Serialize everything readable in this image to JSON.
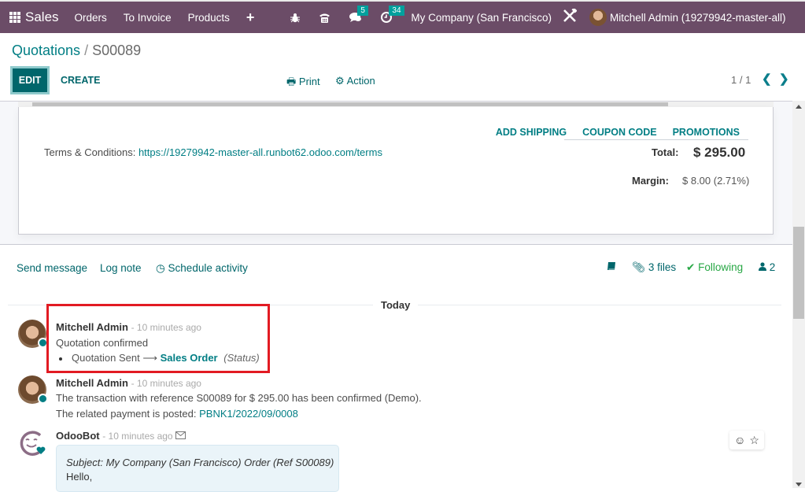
{
  "topbar": {
    "app_name": "Sales",
    "menu": [
      "Orders",
      "To Invoice",
      "Products"
    ],
    "plus_icon": "plus-icon",
    "icons": [
      "bug-icon",
      "phone-icon",
      "chat-icon",
      "clock-icon"
    ],
    "messages_badge": "5",
    "activities_badge": "34",
    "company": "My Company (San Francisco)",
    "tools_icon": "tools-icon",
    "user": "Mitchell Admin (19279942-master-all)"
  },
  "control": {
    "breadcrumb_parent": "Quotations",
    "breadcrumb_sep": "/",
    "breadcrumb_current": "S00089",
    "edit_label": "EDIT",
    "create_label": "CREATE",
    "print_label": "Print",
    "action_label": "Action",
    "pager": "1 / 1"
  },
  "form": {
    "terms_label": "Terms & Conditions: ",
    "terms_url": "https://19279942-master-all.runbot62.odoo.com/terms",
    "links": [
      "ADD SHIPPING",
      "COUPON CODE",
      "PROMOTIONS"
    ],
    "total_label": "Total:",
    "total_value": "$ 295.00",
    "margin_label": "Margin:",
    "margin_value": "$ 8.00 (2.71%)"
  },
  "chatter": {
    "send_message": "Send message",
    "log_note": "Log note",
    "schedule_activity": "Schedule activity",
    "files": "3 files",
    "following": "Following",
    "followers": "2",
    "today": "Today",
    "messages": [
      {
        "author": "Mitchell Admin",
        "date": "- 10 minutes ago",
        "body": "Quotation confirmed",
        "tracking_old": "Quotation Sent",
        "tracking_arrow": "⟶",
        "tracking_new": "Sales Order",
        "tracking_field": "(Status)"
      },
      {
        "author": "Mitchell Admin",
        "date": "- 10 minutes ago",
        "line1": "The transaction with reference S00089 for $ 295.00 has been confirmed (Demo).",
        "line2_prefix": "The related payment is posted: ",
        "line2_link": "PBNK1/2022/09/0008"
      },
      {
        "author": "OdooBot",
        "date": "- 10 minutes ago",
        "subject": "Subject: My Company (San Francisco) Order (Ref S00089)",
        "body": "Hello,"
      }
    ]
  },
  "colors": {
    "topbar": "#6b4c67",
    "primary": "#00666b",
    "link": "#017e84",
    "following": "#28a745",
    "highlight": "#e21b23"
  }
}
